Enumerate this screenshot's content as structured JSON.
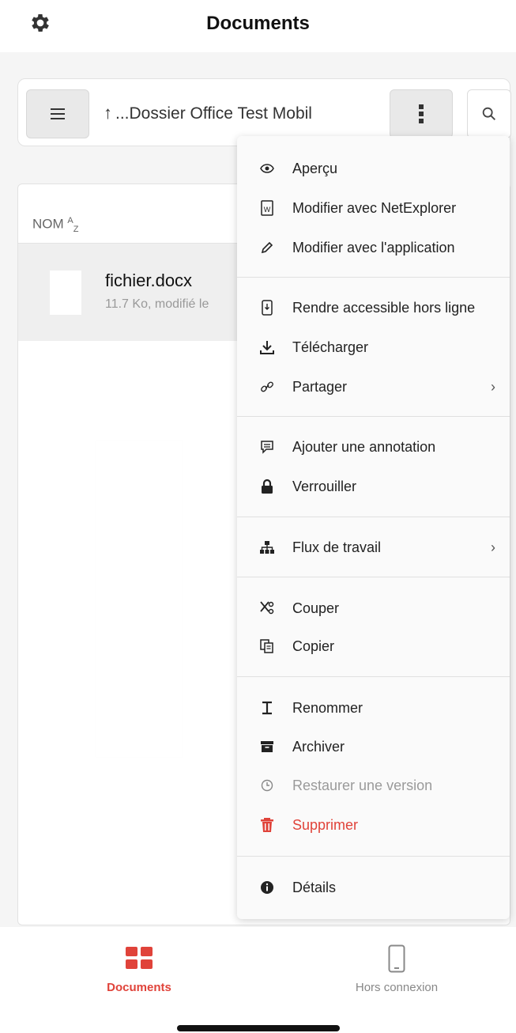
{
  "header": {
    "title": "Documents",
    "settings_icon": "gear-icon"
  },
  "toolbar": {
    "menu_icon": "hamburger-icon",
    "path_arrow": "↑",
    "path": "...Dossier Office Test Mobil",
    "more_icon": "vertical-dots-icon",
    "search_icon": "search-icon"
  },
  "list": {
    "column_header": "NOM",
    "sort_super": "A",
    "sort_sub": "Z",
    "file": {
      "name": "fichier.docx",
      "meta": "11.7 Ko, modifié le"
    }
  },
  "context_menu": {
    "items": [
      {
        "label": "Aperçu",
        "icon": "eye-icon"
      },
      {
        "label": "Modifier avec NetExplorer",
        "icon": "word-file-icon"
      },
      {
        "label": "Modifier avec l'application",
        "icon": "pencil-icon"
      },
      {
        "label": "Rendre accessible hors ligne",
        "icon": "phone-download-icon"
      },
      {
        "label": "Télécharger",
        "icon": "download-icon"
      },
      {
        "label": "Partager",
        "icon": "link-icon",
        "chevron": "›"
      },
      {
        "label": "Ajouter une annotation",
        "icon": "comment-icon"
      },
      {
        "label": "Verrouiller",
        "icon": "lock-icon"
      },
      {
        "label": "Flux de travail",
        "icon": "workflow-icon",
        "chevron": "›"
      },
      {
        "label": "Couper",
        "icon": "scissors-icon"
      },
      {
        "label": "Copier",
        "icon": "copy-icon"
      },
      {
        "label": "Renommer",
        "icon": "text-cursor-icon"
      },
      {
        "label": "Archiver",
        "icon": "archive-icon"
      },
      {
        "label": "Restaurer une version",
        "icon": "clock-icon",
        "disabled": true
      },
      {
        "label": "Supprimer",
        "icon": "trash-icon",
        "danger": true
      },
      {
        "label": "Détails",
        "icon": "info-icon"
      }
    ]
  },
  "bottom_nav": {
    "documents_label": "Documents",
    "offline_label": "Hors connexion"
  },
  "colors": {
    "accent": "#e0433a",
    "muted": "#9a9a9a"
  }
}
